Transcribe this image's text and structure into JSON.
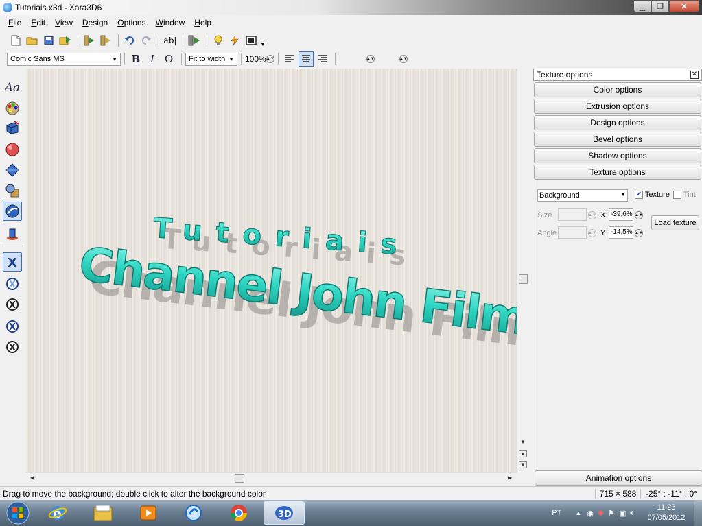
{
  "window": {
    "title": "Tutoriais.x3d - Xara3D6"
  },
  "menu": [
    "File",
    "Edit",
    "View",
    "Design",
    "Options",
    "Window",
    "Help"
  ],
  "toolbar": {
    "font_name": "Comic Sans MS",
    "bold": "B",
    "italic": "I",
    "outline": "O",
    "fit_mode": "Fit to width",
    "zoom": "100%"
  },
  "canvas": {
    "line1": "Tutoriais",
    "line2": "Channel John Films",
    "text_color": "#2fd6c3",
    "shadow_color": "#8f8a86"
  },
  "panel": {
    "header": "Texture options",
    "buttons": [
      "Color options",
      "Extrusion options",
      "Design options",
      "Bevel options",
      "Shadow options",
      "Texture options"
    ],
    "target": "Background",
    "texture_label": "Texture",
    "texture_checked": true,
    "tint_label": "Tint",
    "tint_checked": false,
    "size_label": "Size",
    "angle_label": "Angle",
    "x_label": "X",
    "x_value": "-39,6%",
    "y_label": "Y",
    "y_value": "-14,5%",
    "load_button": "Load texture",
    "animation_button": "Animation options"
  },
  "status": {
    "message": "Drag to move the background; double click to alter the background color",
    "size": "715 × 588",
    "angle": "-25° : -11° : 0°"
  },
  "taskbar": {
    "language": "PT",
    "time": "11:23",
    "date": "07/05/2012"
  }
}
